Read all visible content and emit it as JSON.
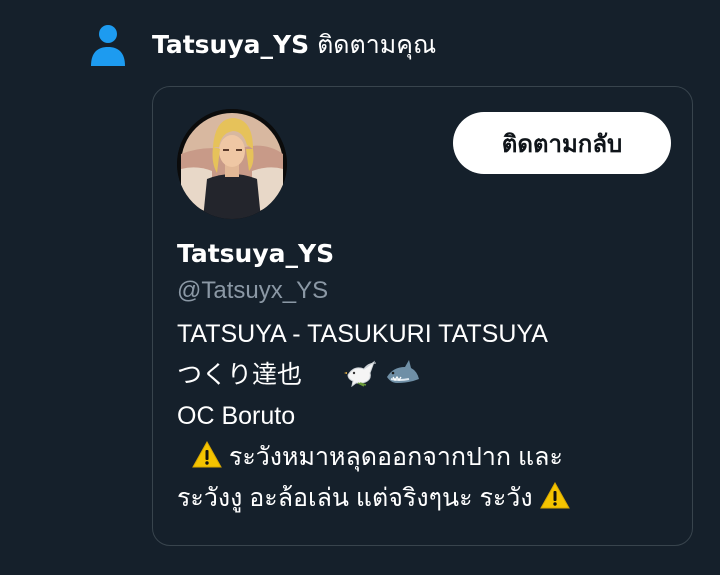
{
  "notification": {
    "icon": "person-icon",
    "name": "Tatsuya_YS",
    "action": "ติดตามคุณ"
  },
  "profile": {
    "avatar_icon": "profile-avatar",
    "follow_back_label": "ติดตามกลับ",
    "display_name": "Tatsuya_YS",
    "handle": "@Tatsuyx_YS",
    "bio": {
      "line1": "TATSUYA - TASUKURI TATSUYA",
      "line2_text": "つくり達也",
      "line2_emojis": [
        "dove-icon",
        "shark-icon"
      ],
      "line3": "OC Boruto",
      "line4_text": "ระวังหมาหลุดออกจากปาก และ",
      "line5_text": "ระวังงู อะล้อเล่น แต่จริงๆนะ ระวัง",
      "warning_icon": "warning-icon"
    }
  },
  "colors": {
    "background": "#15202b",
    "accent": "#1d9bf0",
    "border": "#38444d",
    "secondary_text": "#8b98a5",
    "button_bg": "#ffffff",
    "button_text": "#0f1419"
  }
}
